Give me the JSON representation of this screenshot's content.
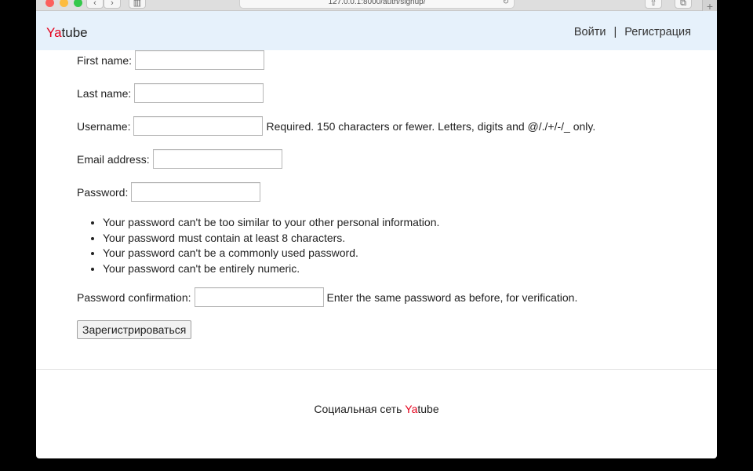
{
  "browser": {
    "url": "127.0.0.1:8000/auth/signup/",
    "back_glyph": "‹",
    "forward_glyph": "›",
    "sidebar_glyph": "▥",
    "reload_glyph": "↻",
    "share_glyph": "⇧",
    "tabs_glyph": "⧉",
    "new_tab_glyph": "+"
  },
  "navbar": {
    "brand_prefix": "Ya",
    "brand_suffix": "tube",
    "login": "Войти",
    "separator": "|",
    "signup": "Регистрация"
  },
  "form": {
    "first_name": {
      "label": "First name:",
      "value": ""
    },
    "last_name": {
      "label": "Last name:",
      "value": ""
    },
    "username": {
      "label": "Username:",
      "value": "",
      "help": "Required. 150 characters or fewer. Letters, digits and @/./+/-/_ only."
    },
    "email": {
      "label": "Email address:",
      "value": ""
    },
    "password": {
      "label": "Password:",
      "value": ""
    },
    "password_rules": [
      "Your password can't be too similar to your other personal information.",
      "Your password must contain at least 8 characters.",
      "Your password can't be a commonly used password.",
      "Your password can't be entirely numeric."
    ],
    "password_confirmation": {
      "label": "Password confirmation:",
      "value": "",
      "help": "Enter the same password as before, for verification."
    },
    "submit_label": "Зарегистрироваться"
  },
  "footer": {
    "prefix": "Социальная сеть ",
    "brand_prefix": "Ya",
    "brand_suffix": "tube"
  },
  "colors": {
    "brand_red": "#e4001b",
    "navbar_bg": "#e6f1fb"
  }
}
